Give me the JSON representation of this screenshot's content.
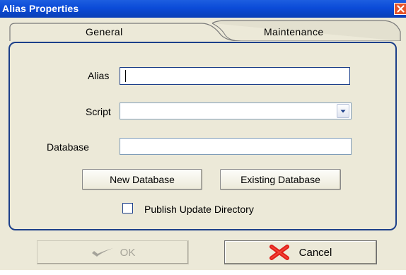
{
  "window": {
    "title": "Alias Properties"
  },
  "tabs": [
    {
      "label": "General",
      "selected": true
    },
    {
      "label": "Maintenance",
      "selected": false
    }
  ],
  "form": {
    "alias_label": "Alias",
    "alias_value": "",
    "script_label": "Script",
    "script_value": "",
    "database_label": "Database",
    "database_value": "",
    "new_database_label": "New Database",
    "existing_database_label": "Existing Database",
    "publish_label": "Publish Update Directory",
    "publish_checked": false
  },
  "footer": {
    "ok_label": "OK",
    "ok_enabled": false,
    "cancel_label": "Cancel"
  },
  "colors": {
    "titlebar": "#0b4bd8",
    "dialog_background": "#ece9d8",
    "panel_border": "#1c3f8a",
    "cancel_icon": "#e0201a"
  },
  "icons": {
    "close": "close-icon",
    "ok": "checkmark-icon",
    "cancel": "red-x-icon",
    "combo": "chevron-down-icon"
  }
}
